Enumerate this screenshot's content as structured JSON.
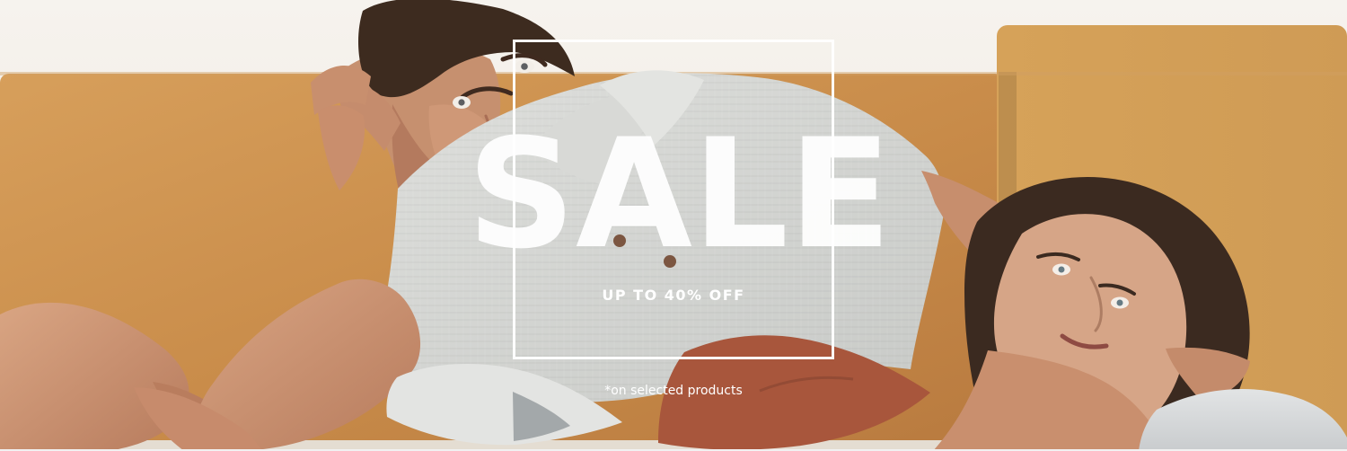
{
  "banner": {
    "headline": "SALE",
    "subheadline": "UP TO 40% OFF",
    "footnote": "*on selected products"
  },
  "colors": {
    "text": "#ffffff",
    "sofa": "#c98c4a",
    "wall": "#f4f1ec",
    "shirt": "#d6d7d4",
    "skin": "#c98f6e",
    "hair": "#3b2a20",
    "top": "#a54c35"
  }
}
